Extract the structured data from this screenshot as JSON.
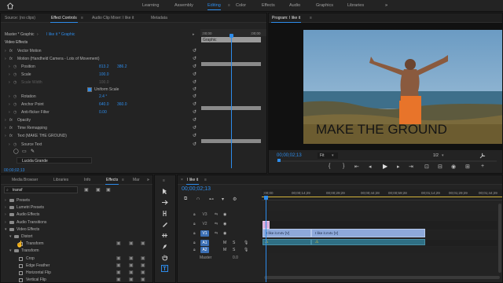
{
  "workspaces": [
    "Learning",
    "Assembly",
    "Editing",
    "Color",
    "Effects",
    "Audio",
    "Graphics",
    "Libraries"
  ],
  "active_workspace": "Editing",
  "more_symbol": "»",
  "source_panel": {
    "tabs": [
      "Source: (no clips)",
      "Effect Controls",
      "Audio Clip Mixer: I like it",
      "Metadata"
    ],
    "active_tab": "Effect Controls",
    "menu_symbol": "≡",
    "master_label": "Master * Graphic",
    "sequence_label": "I like it * Graphic",
    "mini_ruler": [
      ";00;00",
      ";00;00"
    ],
    "graphic_bar_label": "Graphic",
    "section_video_effects": "Video Effects",
    "rows": [
      {
        "label": "Vector Motion",
        "indent": 0,
        "value1": "",
        "value2": ""
      },
      {
        "label": "Motion (Handheld Camera - Lots of Movement)",
        "indent": 0,
        "value1": "",
        "value2": ""
      },
      {
        "label": "Position",
        "indent": 1,
        "value1": "813.2",
        "value2": "386.2"
      },
      {
        "label": "Scale",
        "indent": 1,
        "value1": "100.0",
        "value2": ""
      },
      {
        "label": "Scale Width",
        "indent": 1,
        "value1": "100.0",
        "value2": "",
        "disabled": true
      },
      {
        "label": "Uniform Scale",
        "indent": 3,
        "value1": "",
        "value2": "",
        "checkbox": true
      },
      {
        "label": "Rotation",
        "indent": 1,
        "value1": "2.4 °",
        "value2": ""
      },
      {
        "label": "Anchor Point",
        "indent": 1,
        "value1": "640.0",
        "value2": "360.0"
      },
      {
        "label": "Anti-flicker Filter",
        "indent": 1,
        "value1": "0.00",
        "value2": ""
      },
      {
        "label": "Opacity",
        "indent": 0,
        "value1": "",
        "value2": ""
      },
      {
        "label": "Time Remapping",
        "indent": 0,
        "value1": "",
        "value2": ""
      },
      {
        "label": "Text (MAKE THE GROUND)",
        "indent": 0,
        "value1": "",
        "value2": ""
      },
      {
        "label": "Source Text",
        "indent": 1,
        "value1": "",
        "value2": ""
      }
    ],
    "font_value": "Lucida Grande",
    "timecode": "00;00;02;13"
  },
  "program_panel": {
    "title": "Program: I like it",
    "menu_symbol": "≡",
    "overlay_text": "MAKE THE GROUND",
    "timecode": "00;00;02;13",
    "fit_label": "Fit",
    "resolution": "1/2",
    "colors": {
      "sky": "#6f9fc4",
      "sea": "#3e6f8a",
      "ground": "#5d5a3e",
      "timecode": "#2d8ceb"
    }
  },
  "effects_panel": {
    "tabs": [
      "Media Browser",
      "Libraries",
      "Info",
      "Effects",
      "Mar"
    ],
    "active_tab": "Effects",
    "menu_symbol": "≡",
    "more_symbol": "»",
    "search_value": "transf",
    "tree": [
      {
        "label": "Presets",
        "level": 0,
        "type": "folder"
      },
      {
        "label": "Lumetri Presets",
        "level": 0,
        "type": "folder"
      },
      {
        "label": "Audio Effects",
        "level": 0,
        "type": "folder"
      },
      {
        "label": "Audio Transitions",
        "level": 0,
        "type": "folder"
      },
      {
        "label": "Video Effects",
        "level": 0,
        "type": "folder",
        "open": true
      },
      {
        "label": "Distort",
        "level": 1,
        "type": "folder",
        "open": true
      },
      {
        "label": "Transform",
        "level": 2,
        "type": "effect",
        "hovered": true
      },
      {
        "label": "Transform",
        "level": 1,
        "type": "folder",
        "open": true
      },
      {
        "label": "Crop",
        "level": 2,
        "type": "effect"
      },
      {
        "label": "Edge Feather",
        "level": 2,
        "type": "effect"
      },
      {
        "label": "Horizontal Flip",
        "level": 2,
        "type": "effect"
      },
      {
        "label": "Vertical Flip",
        "level": 2,
        "type": "effect"
      }
    ]
  },
  "timeline_panel": {
    "sequence_name": "I like it",
    "close_symbol": "×",
    "menu_symbol": "≡",
    "timecode": "00;00;02;13",
    "ruler": [
      ";00;00",
      "00;00;14;29",
      "00;00;29;29",
      "00;00;44;28",
      "00;00;59;28",
      "00;01;14;29",
      "00;01;29;29",
      "00;01;44;29"
    ],
    "tracks": [
      {
        "name": "V3",
        "kind": "video"
      },
      {
        "name": "V2",
        "kind": "video"
      },
      {
        "name": "V1",
        "kind": "video",
        "target": "V1"
      },
      {
        "name": "A1",
        "kind": "audio",
        "target": "A1"
      },
      {
        "name": "A2",
        "kind": "audio",
        "target": "A2"
      }
    ],
    "ms_labels": [
      "M",
      "S"
    ],
    "master_label": "Master",
    "master_value": "0.0",
    "clips": [
      {
        "label": "I like it.m4v [V]"
      },
      {
        "label": "I like it.m4v [V]"
      }
    ]
  },
  "tools": [
    "selection-tool",
    "track-select-tool",
    "ripple-edit-tool",
    "razor-tool",
    "slip-tool",
    "pen-tool",
    "hand-tool",
    "type-tool"
  ]
}
